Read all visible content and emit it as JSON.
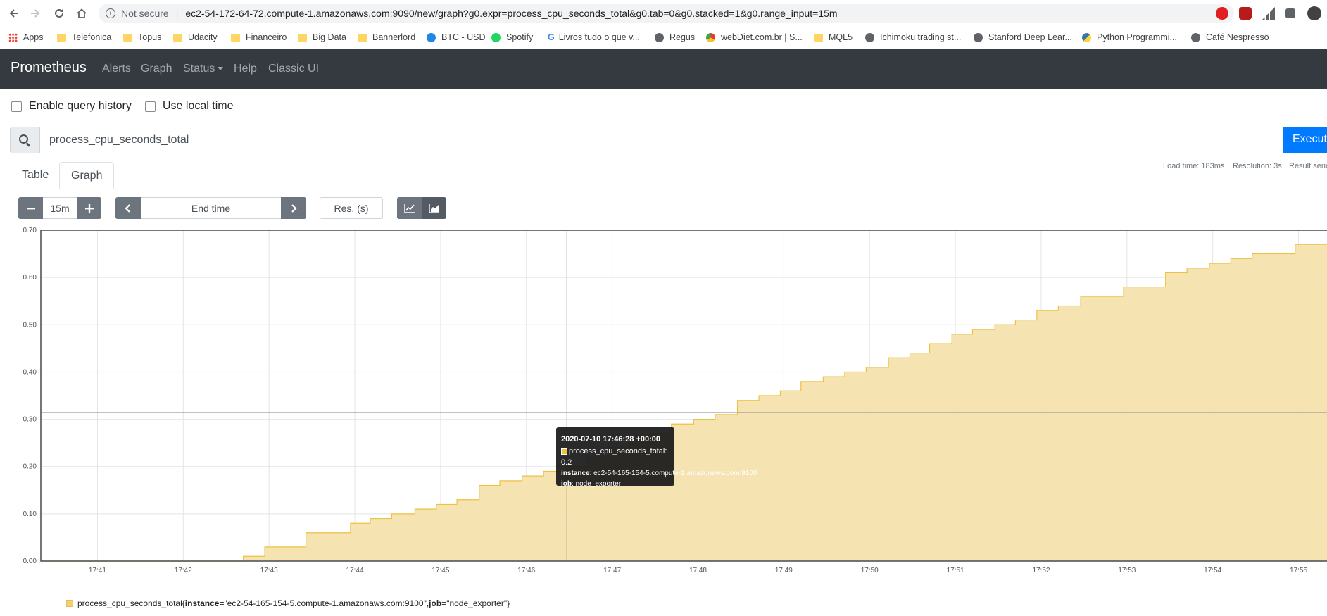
{
  "browser": {
    "security_label": "Not secure",
    "url": "ec2-54-172-64-72.compute-1.amazonaws.com:9090/new/graph?g0.expr=process_cpu_seconds_total&g0.tab=0&g0.stacked=1&g0.range_input=15m"
  },
  "bookmarks": [
    {
      "label": "Apps",
      "icon": "apps-grid-icon"
    },
    {
      "label": "Telefonica",
      "icon": "folder-icon"
    },
    {
      "label": "Topus",
      "icon": "folder-icon"
    },
    {
      "label": "Udacity",
      "icon": "folder-icon"
    },
    {
      "label": "Financeiro",
      "icon": "folder-icon"
    },
    {
      "label": "Big Data",
      "icon": "folder-icon"
    },
    {
      "label": "Bannerlord",
      "icon": "folder-icon"
    },
    {
      "label": "BTC - USD",
      "icon": "btc-icon"
    },
    {
      "label": "Spotify",
      "icon": "spotify-icon"
    },
    {
      "label": "Livros tudo o que v...",
      "icon": "google-icon"
    },
    {
      "label": "Regus",
      "icon": "globe-icon"
    },
    {
      "label": "webDiet.com.br | S...",
      "icon": "webdiet-icon"
    },
    {
      "label": "MQL5",
      "icon": "folder-icon"
    },
    {
      "label": "Ichimoku trading st...",
      "icon": "globe-icon"
    },
    {
      "label": "Stanford Deep Lear...",
      "icon": "globe-icon"
    },
    {
      "label": "Python Programmi...",
      "icon": "python-icon"
    },
    {
      "label": "Café Nespresso",
      "icon": "globe-icon"
    }
  ],
  "navbar": {
    "brand": "Prometheus",
    "links": [
      "Alerts",
      "Graph",
      "Status",
      "Help",
      "Classic UI"
    ]
  },
  "options": {
    "query_history": "Enable query history",
    "local_time": "Use local time"
  },
  "query": {
    "expression": "process_cpu_seconds_total",
    "execute_label": "Execute"
  },
  "stats": {
    "load_time": "Load time: 183ms",
    "resolution": "Resolution: 3s",
    "result_series": "Result series"
  },
  "tabs": [
    "Table",
    "Graph"
  ],
  "controls": {
    "range": "15m",
    "end_time_placeholder": "End time",
    "resolution_placeholder": "Res. (s)"
  },
  "tooltip": {
    "timestamp": "2020-07-10 17:46:28 +00:00",
    "series_line": "process_cpu_seconds_total: 0.2",
    "instance_key": "instance",
    "instance_value": "ec2-54-165-154-5.compute-1.amazonaws.com:9100",
    "job_key": "job",
    "job_value": "node_exporter"
  },
  "legend": {
    "metric": "process_cpu_seconds_total",
    "instance_key": "instance",
    "instance_value": "\"ec2-54-165-154-5.compute-1.amazonaws.com:9100\"",
    "job_key": "job",
    "job_value": "\"node_exporter\""
  },
  "colors": {
    "series_fill": "#f6e2ae",
    "series_line": "#edc240",
    "navbar": "#343a40",
    "execute": "#007bff"
  },
  "chart_data": {
    "type": "area",
    "stacked": true,
    "grid": true,
    "ylim": [
      0,
      0.7
    ],
    "xlim_minutes": [
      40.34,
      55.34
    ],
    "y_ticks": [
      "0.00",
      "0.10",
      "0.20",
      "0.30",
      "0.40",
      "0.50",
      "0.60",
      "0.70"
    ],
    "x_ticks": [
      "17:41",
      "17:42",
      "17:43",
      "17:44",
      "17:45",
      "17:46",
      "17:47",
      "17:48",
      "17:49",
      "17:50",
      "17:51",
      "17:52",
      "17:53",
      "17:54",
      "17:55"
    ],
    "x_tick_minutes": [
      41,
      42,
      43,
      44,
      45,
      46,
      47,
      48,
      49,
      50,
      51,
      52,
      53,
      54,
      55
    ],
    "series": [
      {
        "name": "process_cpu_seconds_total{instance=\"ec2-54-165-154-5.compute-1.amazonaws.com:9100\", job=\"node_exporter\"}",
        "x_minutes": [
          42.46,
          42.7,
          42.95,
          43.43,
          43.95,
          44.18,
          44.43,
          44.7,
          44.95,
          45.19,
          45.45,
          45.69,
          45.95,
          46.2,
          46.46,
          46.71,
          46.95,
          47.2,
          47.45,
          47.69,
          47.95,
          48.2,
          48.46,
          48.71,
          48.96,
          49.2,
          49.46,
          49.71,
          49.96,
          50.22,
          50.47,
          50.7,
          50.96,
          51.2,
          51.46,
          51.7,
          51.95,
          52.2,
          52.46,
          52.71,
          52.96,
          53.22,
          53.45,
          53.7,
          53.96,
          54.21,
          54.46,
          54.71,
          54.96,
          55.2
        ],
        "values": [
          0.0,
          0.01,
          0.03,
          0.06,
          0.08,
          0.09,
          0.1,
          0.11,
          0.12,
          0.13,
          0.16,
          0.17,
          0.18,
          0.19,
          0.2,
          0.22,
          0.24,
          0.26,
          0.27,
          0.29,
          0.3,
          0.31,
          0.34,
          0.35,
          0.36,
          0.38,
          0.39,
          0.4,
          0.41,
          0.43,
          0.44,
          0.46,
          0.48,
          0.49,
          0.5,
          0.51,
          0.53,
          0.54,
          0.56,
          0.56,
          0.58,
          0.58,
          0.61,
          0.62,
          0.63,
          0.64,
          0.65,
          0.65,
          0.67,
          0.67
        ]
      }
    ],
    "hover_x_minute": 46.47
  }
}
